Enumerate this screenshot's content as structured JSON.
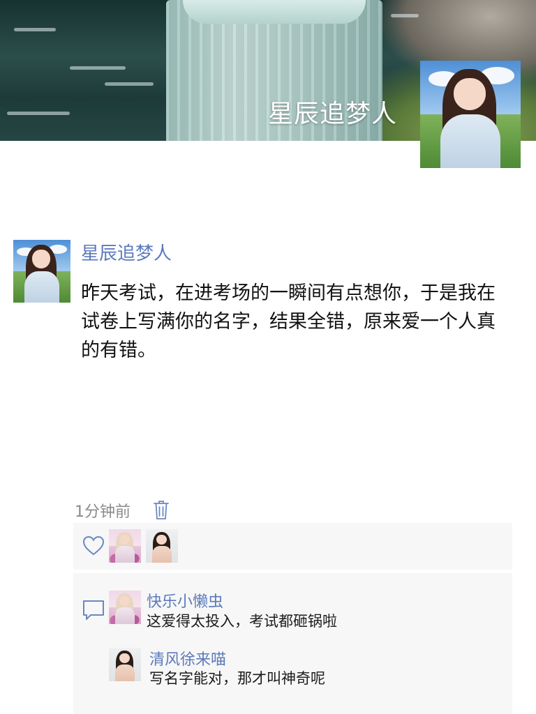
{
  "cover": {
    "title": "星辰追梦人"
  },
  "post": {
    "author": "星辰追梦人",
    "text": "昨天考试，在进考场的一瞬间有点想你，于是我在试卷上写满你的名字，结果全错，原来爱一个人真的有错。",
    "time": "1分钟前"
  },
  "likes": {
    "icon": "heart-outline-icon",
    "users": [
      "pink-portrait",
      "studio-portrait"
    ]
  },
  "comments": {
    "icon": "speech-bubble-icon",
    "items": [
      {
        "name": "快乐小懒虫",
        "text": "这爱得太投入，考试都砸锅啦",
        "avatar": "pink-portrait"
      },
      {
        "name": "清风徐来喵",
        "text": "写名字能对，那才叫神奇呢",
        "avatar": "studio-portrait"
      }
    ]
  },
  "colors": {
    "link": "#5b7abb",
    "panel": "#f7f7f7",
    "meta": "#8a8a8a",
    "icon": "#6b87c2"
  }
}
